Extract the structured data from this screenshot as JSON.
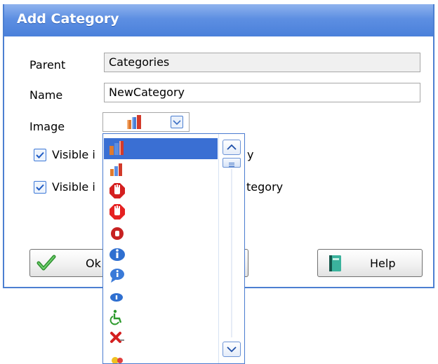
{
  "dialog": {
    "title": "Add Category",
    "parent_label": "Parent",
    "parent_value": "Categories",
    "name_label": "Name",
    "name_value": "NewCategory",
    "image_label": "Image"
  },
  "checkboxes": [
    {
      "label": "Visible i",
      "label_right": "y",
      "checked": true
    },
    {
      "label": "Visible i",
      "label_right": "tegory",
      "checked": true
    }
  ],
  "buttons": {
    "ok_label": "Ok",
    "help_label": "Help"
  },
  "image_dropdown": {
    "selected_icon": "bar-chart-icon",
    "items": [
      {
        "icon": "bar-chart-icon",
        "selected": true
      },
      {
        "icon": "small-bar-chart-icon",
        "selected": false
      },
      {
        "icon": "stop-hand-icon",
        "selected": false
      },
      {
        "icon": "stop-hand-icon",
        "selected": false
      },
      {
        "icon": "small-stop-hand-icon",
        "selected": false
      },
      {
        "icon": "info-icon",
        "selected": false
      },
      {
        "icon": "info-bubble-icon",
        "selected": false
      },
      {
        "icon": "small-info-icon",
        "selected": false
      },
      {
        "icon": "wheelchair-icon",
        "selected": false
      },
      {
        "icon": "delete-x-icon",
        "selected": false
      },
      {
        "icon": "partial-icon",
        "selected": false
      }
    ]
  },
  "colors": {
    "title_bar": "#4a80da",
    "selection": "#3a6fd3",
    "border_blue": "#4c7fd1"
  }
}
